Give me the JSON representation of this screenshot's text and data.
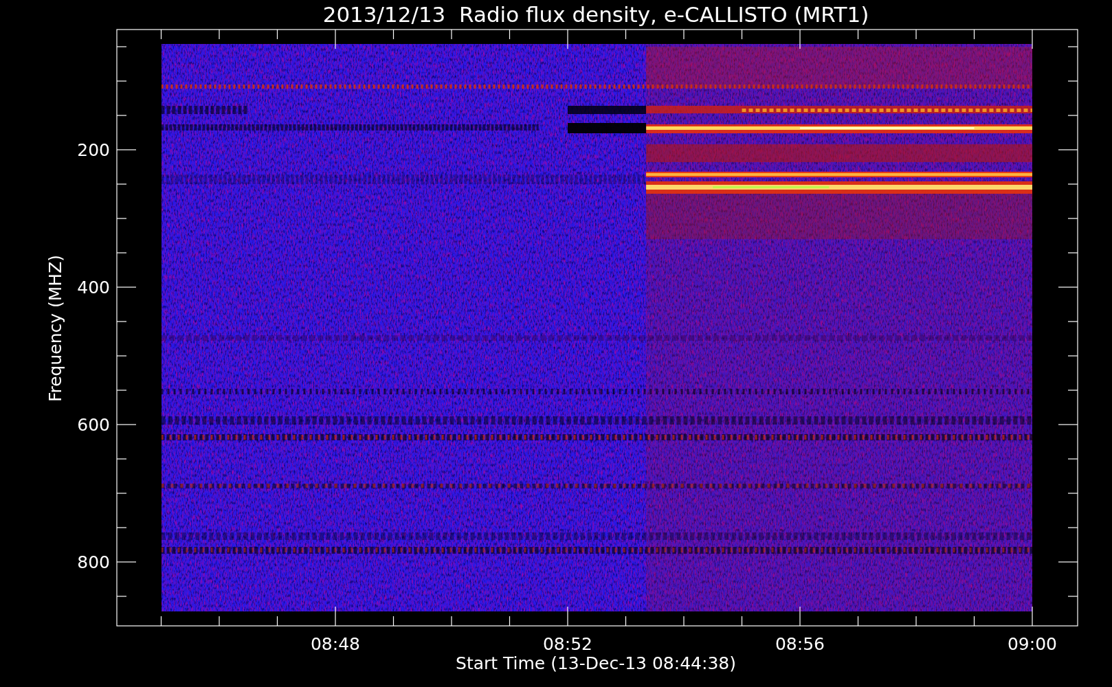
{
  "plot": {
    "title": "2013/12/13  Radio flux density, e-CALLISTO (MRT1)",
    "x_axis": {
      "label": "Start Time (13-Dec-13 08:44:38)",
      "ticks": [
        "08:48",
        "08:52",
        "08:56",
        "09:00"
      ]
    },
    "y_axis": {
      "label": "Frequency (MHZ)",
      "ticks": [
        "200",
        "400",
        "600",
        "800"
      ]
    }
  }
}
